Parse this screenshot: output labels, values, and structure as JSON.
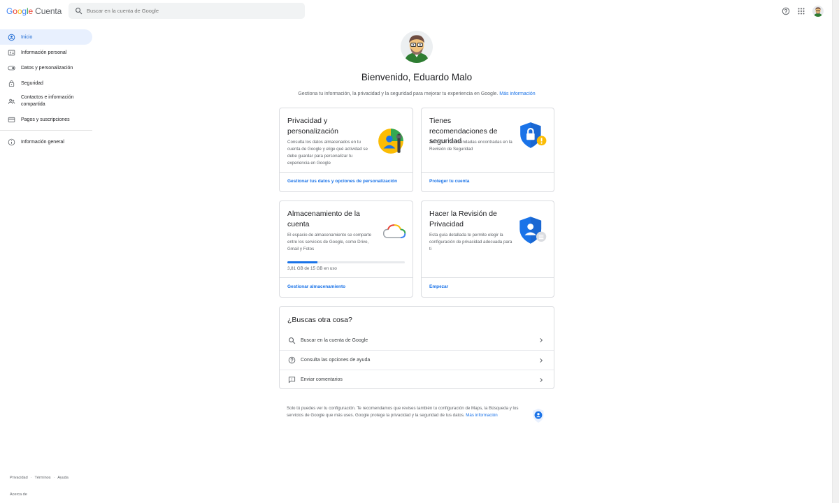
{
  "header": {
    "logo_google": "Google",
    "logo_product": "Cuenta",
    "search_placeholder": "Buscar en la cuenta de Google"
  },
  "sidebar": {
    "items": [
      {
        "label": "Inicio",
        "icon": "home-icon",
        "active": true
      },
      {
        "label": "Información personal",
        "icon": "id-card-icon"
      },
      {
        "label": "Datos y personalización",
        "icon": "toggle-icon"
      },
      {
        "label": "Seguridad",
        "icon": "lock-icon"
      },
      {
        "label": "Contactos e información compartida",
        "icon": "people-icon"
      },
      {
        "label": "Pagos y suscripciones",
        "icon": "credit-card-icon"
      },
      {
        "label": "Información general",
        "icon": "info-icon"
      }
    ],
    "footer_links": [
      "Privacidad",
      "Términos",
      "Ayuda"
    ],
    "about": "Acerca de"
  },
  "main": {
    "welcome": "Bienvenido, Eduardo Malo",
    "intro_text": "Gestiona tu información, la privacidad y la seguridad para mejorar tu experiencia en Google.",
    "intro_link": "Más información",
    "cards": {
      "privacy": {
        "title": "Privacidad y personalización",
        "desc": "Consulta los datos almacenados en tu cuenta de Google y elige qué actividad se debe guardar para personalizar tu experiencia en Google",
        "link": "Gestionar tus datos y opciones de personalización"
      },
      "security": {
        "title": "Tienes recomendaciones de seguridad",
        "desc": "Acciones recomendadas encontradas en la Revisión de Seguridad",
        "link": "Proteger tu cuenta"
      },
      "storage": {
        "title": "Almacenamiento de la cuenta",
        "desc": "El espacio de almacenamiento se comparte entre los servicios de Google, como Drive, Gmail y Fotos",
        "usage": "3,81 GB de 15 GB en uso",
        "used_gb": 3.81,
        "total_gb": 15,
        "link": "Gestionar almacenamiento"
      },
      "privacy_check": {
        "title": "Hacer la Revisión de Privacidad",
        "desc": "Esta guía detallada te permite elegir la configuración de privacidad adecuada para ti",
        "link": "Empezar"
      }
    },
    "more": {
      "title": "¿Buscas otra cosa?",
      "rows": [
        {
          "label": "Buscar en la cuenta de Google",
          "icon": "search-icon"
        },
        {
          "label": "Consulta las opciones de ayuda",
          "icon": "help-icon"
        },
        {
          "label": "Enviar comentarios",
          "icon": "feedback-icon"
        }
      ]
    },
    "notice_text": "Solo tú puedes ver tu configuración. Te recomendamos que revises también tu configuración de Maps, la Búsqueda y los servicios de Google que más uses. Google protege la privacidad y la seguridad de tus datos.",
    "notice_link": "Más información"
  },
  "colors": {
    "accent": "#1a73e8",
    "active_bg": "#e8f0fe",
    "active_text": "#1967d2",
    "border": "#dadce0"
  }
}
